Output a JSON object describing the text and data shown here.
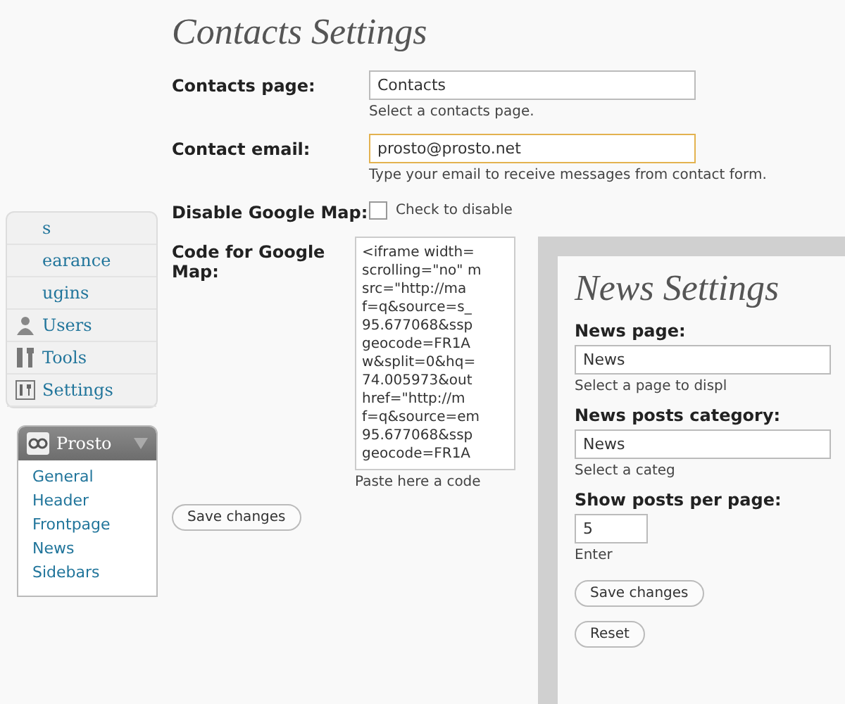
{
  "sidebar": {
    "items": [
      {
        "kind": "plain",
        "label": "s"
      },
      {
        "kind": "plain",
        "label": "earance"
      },
      {
        "kind": "plain",
        "label": "ugins"
      },
      {
        "kind": "users",
        "label": "Users"
      },
      {
        "kind": "tools",
        "label": "Tools"
      },
      {
        "kind": "settings",
        "label": "Settings"
      }
    ]
  },
  "prosto_menu": {
    "title": "Prosto",
    "items": [
      "General",
      "Header",
      "Frontpage",
      "News",
      "Sidebars"
    ]
  },
  "contacts_settings": {
    "title": "Contacts Settings",
    "fields": [
      {
        "kind": "select",
        "label": "Contacts page:",
        "value": "Contacts",
        "hint": "Select a contacts page."
      },
      {
        "kind": "text",
        "label": "Contact email:",
        "value": "prosto@prosto.net",
        "focused": true,
        "hint": "Type your email to receive messages from contact form."
      },
      {
        "kind": "checkbox",
        "label": "Disable Google Map:",
        "checked": false,
        "hint": "Check to disable"
      },
      {
        "kind": "textarea",
        "label": "Code for Google Map:",
        "lines": [
          "<iframe width=",
          "scrolling=\"no\" m",
          "src=\"http://ma",
          "f=q&source=s_",
          "95.677068&ssp",
          "geocode=FR1A",
          "w&split=0&hq=",
          "74.005973&out",
          "href=\"http://m",
          "f=q&source=em",
          "95.677068&ssp",
          "geocode=FR1A"
        ],
        "hint": "Paste here a code"
      }
    ],
    "buttons": [
      "Save changes"
    ]
  },
  "news_settings": {
    "title": "News Settings",
    "fields": [
      {
        "kind": "select",
        "label": "News page:",
        "value": "News",
        "hint": "Select a page to displ"
      },
      {
        "kind": "select",
        "label": "News posts category:",
        "value": "News",
        "hint": "Select a categ"
      },
      {
        "kind": "text",
        "label": "Show posts per page:",
        "value": "5",
        "focused": false,
        "hint": "Enter"
      }
    ],
    "buttons": [
      "Save changes",
      "Reset"
    ]
  }
}
